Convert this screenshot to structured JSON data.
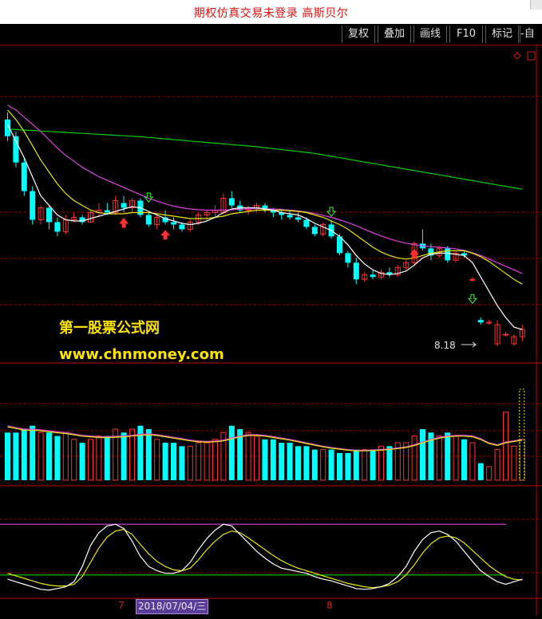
{
  "window": {
    "title": "期权仿真交易未登录   高斯贝尔"
  },
  "toolbar": {
    "buttons": [
      {
        "label": "复权"
      },
      {
        "label": "叠加"
      },
      {
        "label": "画线"
      },
      {
        "label": "F10"
      },
      {
        "label": "标记"
      },
      {
        "label": "-自选"
      }
    ]
  },
  "watermark": {
    "line1": "第一股票公式网",
    "line2": "www.chnmoney.com"
  },
  "price_panel": {
    "min_label": "8.18"
  },
  "date_axis": {
    "tick_7": "7",
    "selected_date": "2018/07/04/三",
    "tick_8": "8"
  },
  "colors": {
    "up": "#ff3030",
    "down": "#00ffff",
    "ma_short": "#ffffff",
    "ma_mid": "#e8e800",
    "ma_long": "#e040e0",
    "ma_longest": "#00d000",
    "grid": "#9a0000",
    "kdj_k": "#ffffff",
    "kdj_d": "#e8e800",
    "level_high": "#e040e0",
    "level_low": "#00d000"
  },
  "chart_data": {
    "type": "candlestick",
    "candles": [
      [
        22.2,
        22.5,
        21.3,
        21.5
      ],
      [
        21.5,
        21.7,
        20.2,
        20.4
      ],
      [
        20.4,
        20.6,
        19.0,
        19.2
      ],
      [
        19.2,
        19.4,
        17.8,
        18.0
      ],
      [
        18.0,
        18.6,
        17.8,
        18.5
      ],
      [
        18.5,
        18.6,
        17.6,
        17.9
      ],
      [
        17.9,
        18.1,
        17.3,
        17.5
      ],
      [
        17.5,
        18.2,
        17.4,
        18.0
      ],
      [
        18.0,
        18.3,
        17.9,
        18.1
      ],
      [
        18.1,
        18.2,
        17.8,
        17.9
      ],
      [
        17.9,
        18.4,
        17.9,
        18.3
      ],
      [
        18.3,
        18.7,
        18.1,
        18.4
      ],
      [
        18.4,
        18.7,
        18.2,
        18.3
      ],
      [
        18.3,
        19.0,
        18.2,
        18.8
      ],
      [
        18.7,
        19.0,
        18.3,
        18.5
      ],
      [
        18.5,
        18.9,
        18.3,
        18.8
      ],
      [
        18.8,
        18.9,
        18.1,
        18.2
      ],
      [
        18.2,
        18.3,
        17.7,
        17.8
      ],
      [
        17.8,
        18.2,
        17.6,
        18.1
      ],
      [
        18.1,
        18.4,
        17.8,
        17.9
      ],
      [
        17.9,
        18.1,
        17.6,
        17.8
      ],
      [
        17.8,
        17.9,
        17.5,
        17.6
      ],
      [
        17.6,
        18.0,
        17.5,
        17.9
      ],
      [
        17.9,
        18.3,
        17.8,
        18.2
      ],
      [
        18.2,
        18.4,
        18.0,
        18.3
      ],
      [
        18.3,
        18.6,
        18.1,
        18.4
      ],
      [
        18.3,
        19.1,
        18.2,
        18.9
      ],
      [
        18.9,
        19.2,
        18.5,
        18.6
      ],
      [
        18.6,
        18.8,
        18.3,
        18.4
      ],
      [
        18.4,
        18.6,
        18.2,
        18.5
      ],
      [
        18.5,
        18.7,
        18.3,
        18.6
      ],
      [
        18.6,
        18.7,
        18.3,
        18.4
      ],
      [
        18.4,
        18.5,
        18.1,
        18.3
      ],
      [
        18.3,
        18.4,
        18.0,
        18.2
      ],
      [
        18.2,
        18.4,
        18.0,
        18.1
      ],
      [
        18.1,
        18.3,
        17.9,
        18.0
      ],
      [
        18.0,
        18.1,
        17.6,
        17.7
      ],
      [
        17.7,
        17.8,
        17.3,
        17.4
      ],
      [
        17.4,
        17.9,
        17.3,
        17.8
      ],
      [
        17.8,
        18.0,
        17.2,
        17.3
      ],
      [
        17.3,
        17.4,
        16.5,
        16.6
      ],
      [
        16.6,
        16.7,
        16.0,
        16.2
      ],
      [
        16.2,
        16.4,
        15.3,
        15.5
      ],
      [
        15.5,
        15.8,
        15.4,
        15.7
      ],
      [
        15.7,
        15.9,
        15.5,
        15.6
      ],
      [
        15.6,
        15.9,
        15.5,
        15.8
      ],
      [
        15.8,
        16.0,
        15.6,
        15.7
      ],
      [
        15.7,
        16.1,
        15.6,
        16.0
      ],
      [
        16.0,
        16.3,
        15.9,
        16.2
      ],
      [
        16.2,
        17.1,
        16.1,
        17.0
      ],
      [
        17.0,
        17.6,
        16.7,
        16.8
      ],
      [
        16.8,
        17.0,
        16.3,
        16.5
      ],
      [
        16.5,
        16.9,
        16.4,
        16.8
      ],
      [
        16.8,
        16.9,
        16.2,
        16.3
      ],
      [
        16.3,
        16.7,
        16.2,
        16.6
      ],
      [
        16.6,
        16.7,
        16.4,
        16.5
      ],
      [
        15.5,
        15.6,
        15.4,
        15.5
      ],
      [
        13.8,
        13.9,
        13.6,
        13.7
      ],
      [
        13.7,
        13.8,
        13.6,
        13.7
      ],
      [
        12.8,
        13.8,
        12.7,
        13.6
      ],
      [
        13.2,
        13.3,
        13.1,
        13.2
      ],
      [
        12.8,
        13.2,
        12.7,
        13.1
      ],
      [
        13.1,
        13.6,
        12.9,
        13.4
      ]
    ],
    "ma_short": [
      22.0,
      21.3,
      20.6,
      19.8,
      19.0,
      18.6,
      18.2,
      18.0,
      17.95,
      17.95,
      18.05,
      18.15,
      18.25,
      18.35,
      18.45,
      18.55,
      18.5,
      18.35,
      18.2,
      18.05,
      17.95,
      17.85,
      17.8,
      17.85,
      17.95,
      18.1,
      18.3,
      18.45,
      18.5,
      18.5,
      18.5,
      18.45,
      18.4,
      18.3,
      18.25,
      18.2,
      18.05,
      17.85,
      17.7,
      17.55,
      17.3,
      16.95,
      16.5,
      16.15,
      15.9,
      15.75,
      15.7,
      15.75,
      15.85,
      16.1,
      16.4,
      16.55,
      16.6,
      16.6,
      16.55,
      16.5,
      16.2,
      15.6,
      15.0,
      14.4,
      13.9,
      13.5,
      13.4
    ],
    "ma_mid": [
      22.6,
      22.2,
      21.7,
      21.1,
      20.5,
      20.0,
      19.5,
      19.1,
      18.8,
      18.6,
      18.4,
      18.3,
      18.25,
      18.25,
      18.25,
      18.3,
      18.3,
      18.3,
      18.25,
      18.2,
      18.15,
      18.1,
      18.05,
      18.05,
      18.05,
      18.1,
      18.15,
      18.25,
      18.3,
      18.35,
      18.4,
      18.4,
      18.4,
      18.4,
      18.38,
      18.35,
      18.3,
      18.2,
      18.1,
      17.95,
      17.8,
      17.6,
      17.35,
      17.1,
      16.85,
      16.65,
      16.5,
      16.4,
      16.35,
      16.4,
      16.5,
      16.6,
      16.65,
      16.7,
      16.7,
      16.7,
      16.6,
      16.45,
      16.25,
      16.0,
      15.75,
      15.5,
      15.3
    ],
    "ma_long": [
      22.8,
      22.6,
      22.3,
      22.0,
      21.7,
      21.35,
      21.0,
      20.7,
      20.45,
      20.2,
      20.0,
      19.8,
      19.65,
      19.5,
      19.35,
      19.2,
      19.05,
      18.9,
      18.78,
      18.67,
      18.57,
      18.5,
      18.45,
      18.42,
      18.4,
      18.4,
      18.4,
      18.42,
      18.44,
      18.45,
      18.46,
      18.46,
      18.45,
      18.43,
      18.4,
      18.37,
      18.32,
      18.26,
      18.18,
      18.1,
      18.0,
      17.88,
      17.75,
      17.6,
      17.45,
      17.32,
      17.2,
      17.1,
      17.02,
      16.95,
      16.9,
      16.87,
      16.85,
      16.82,
      16.78,
      16.72,
      16.62,
      16.5,
      16.35,
      16.2,
      16.05,
      15.9,
      15.75
    ],
    "ma_longest": [
      21.8,
      21.78,
      21.76,
      21.74,
      21.72,
      21.7,
      21.68,
      21.66,
      21.64,
      21.62,
      21.6,
      21.58,
      21.56,
      21.54,
      21.52,
      21.5,
      21.48,
      21.45,
      21.42,
      21.39,
      21.36,
      21.33,
      21.3,
      21.27,
      21.24,
      21.21,
      21.18,
      21.15,
      21.12,
      21.09,
      21.06,
      21.02,
      20.98,
      20.94,
      20.9,
      20.86,
      20.82,
      20.78,
      20.72,
      20.66,
      20.6,
      20.54,
      20.48,
      20.42,
      20.36,
      20.3,
      20.24,
      20.18,
      20.12,
      20.06,
      20.0,
      19.94,
      19.88,
      19.82,
      19.76,
      19.7,
      19.64,
      19.58,
      19.52,
      19.46,
      19.4,
      19.34,
      19.28
    ],
    "price_range": [
      12.5,
      24.0
    ],
    "volume": [
      14,
      14,
      15,
      16,
      14,
      14,
      13,
      14,
      12,
      11,
      12,
      13,
      13,
      15,
      14,
      15,
      16,
      15,
      12,
      11,
      11,
      10,
      10,
      11,
      11,
      12,
      14,
      16,
      15,
      14,
      13,
      12,
      12,
      11,
      11,
      10,
      10,
      9,
      9,
      9,
      8,
      8,
      9,
      9,
      9,
      10,
      10,
      11,
      11,
      13,
      15,
      14,
      13,
      14,
      13,
      12,
      11,
      5,
      4,
      9,
      20,
      10,
      12
    ],
    "volume_ma": [
      16,
      15.5,
      15,
      15,
      14.8,
      14.5,
      14.2,
      14,
      13.6,
      13.2,
      13,
      12.8,
      12.8,
      12.9,
      13,
      13.2,
      13.5,
      13.6,
      13.4,
      13,
      12.6,
      12.2,
      11.8,
      11.5,
      11.4,
      11.5,
      11.8,
      12.4,
      13,
      13.4,
      13.4,
      13.2,
      12.8,
      12.4,
      12,
      11.5,
      11,
      10.5,
      10,
      9.6,
      9.3,
      9,
      8.8,
      8.8,
      8.9,
      9,
      9.2,
      9.5,
      9.8,
      10.4,
      11.2,
      12,
      12.6,
      13,
      13.2,
      13.2,
      13,
      12.2,
      11,
      10.4,
      11.2,
      11.6,
      12
    ],
    "volume_max": 30,
    "kdj_k": [
      15,
      12,
      9,
      6,
      3,
      2,
      4,
      6,
      12,
      30,
      55,
      70,
      78,
      80,
      75,
      60,
      42,
      30,
      25,
      22,
      22,
      25,
      35,
      50,
      63,
      73,
      80,
      78,
      68,
      58,
      48,
      40,
      33,
      28,
      26,
      24,
      22,
      18,
      15,
      13,
      10,
      7,
      4,
      3,
      4,
      6,
      10,
      18,
      30,
      48,
      62,
      70,
      72,
      68,
      60,
      48,
      36,
      25,
      18,
      12,
      9,
      12,
      15
    ],
    "kdj_d": [
      22,
      19,
      16,
      13,
      10,
      8,
      7,
      7,
      9,
      18,
      35,
      52,
      65,
      72,
      74,
      68,
      56,
      45,
      36,
      30,
      26,
      25,
      28,
      38,
      50,
      60,
      68,
      72,
      70,
      64,
      57,
      50,
      43,
      37,
      32,
      28,
      25,
      22,
      19,
      16,
      13,
      10,
      8,
      6,
      5,
      6,
      8,
      12,
      20,
      32,
      46,
      57,
      64,
      66,
      64,
      58,
      49,
      40,
      31,
      24,
      18,
      15,
      14
    ],
    "kdj_levels": [
      80,
      20
    ],
    "kdj_range": [
      0,
      100
    ]
  }
}
